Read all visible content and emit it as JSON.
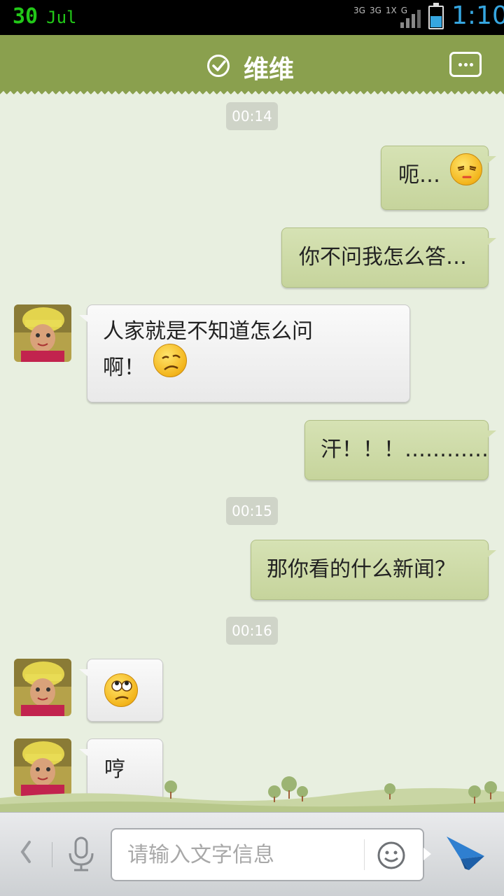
{
  "status_bar": {
    "day": "30",
    "month": "Jul",
    "net_labels": [
      "3G",
      "3G",
      "1X",
      "G"
    ],
    "time": "1:10",
    "battery_level": 0.55
  },
  "header": {
    "title": "维维",
    "menu_icon": "more-dots-icon",
    "verified_icon": "check-circle-icon"
  },
  "messages": [
    {
      "type": "timestamp",
      "text": "00:14"
    },
    {
      "type": "sent",
      "text": "呃…",
      "emoji": "squint-face"
    },
    {
      "type": "sent",
      "text": "你不问我怎么答…"
    },
    {
      "type": "received",
      "text": "人家就是不知道怎么问",
      "text2": "啊！",
      "emoji": "sad-face"
    },
    {
      "type": "sent",
      "text": "汗！！！…………"
    },
    {
      "type": "timestamp",
      "text": "00:15"
    },
    {
      "type": "sent",
      "text": "那你看的什么新闻？"
    },
    {
      "type": "timestamp",
      "text": "00:16"
    },
    {
      "type": "received",
      "emoji": "eye-roll-face"
    },
    {
      "type": "received",
      "text": "哼"
    }
  ],
  "input_bar": {
    "placeholder": "请输入文字信息",
    "back_icon": "chevron-left-icon",
    "mic_icon": "microphone-icon",
    "emoji_icon": "smiley-icon",
    "send_icon": "paper-plane-icon"
  },
  "colors": {
    "header": "#8aa04e",
    "background": "#e8efe0",
    "sent_bubble": "#ccd9a4",
    "received_bubble": "#f2f2f2",
    "accent_blue": "#36a6e0"
  }
}
